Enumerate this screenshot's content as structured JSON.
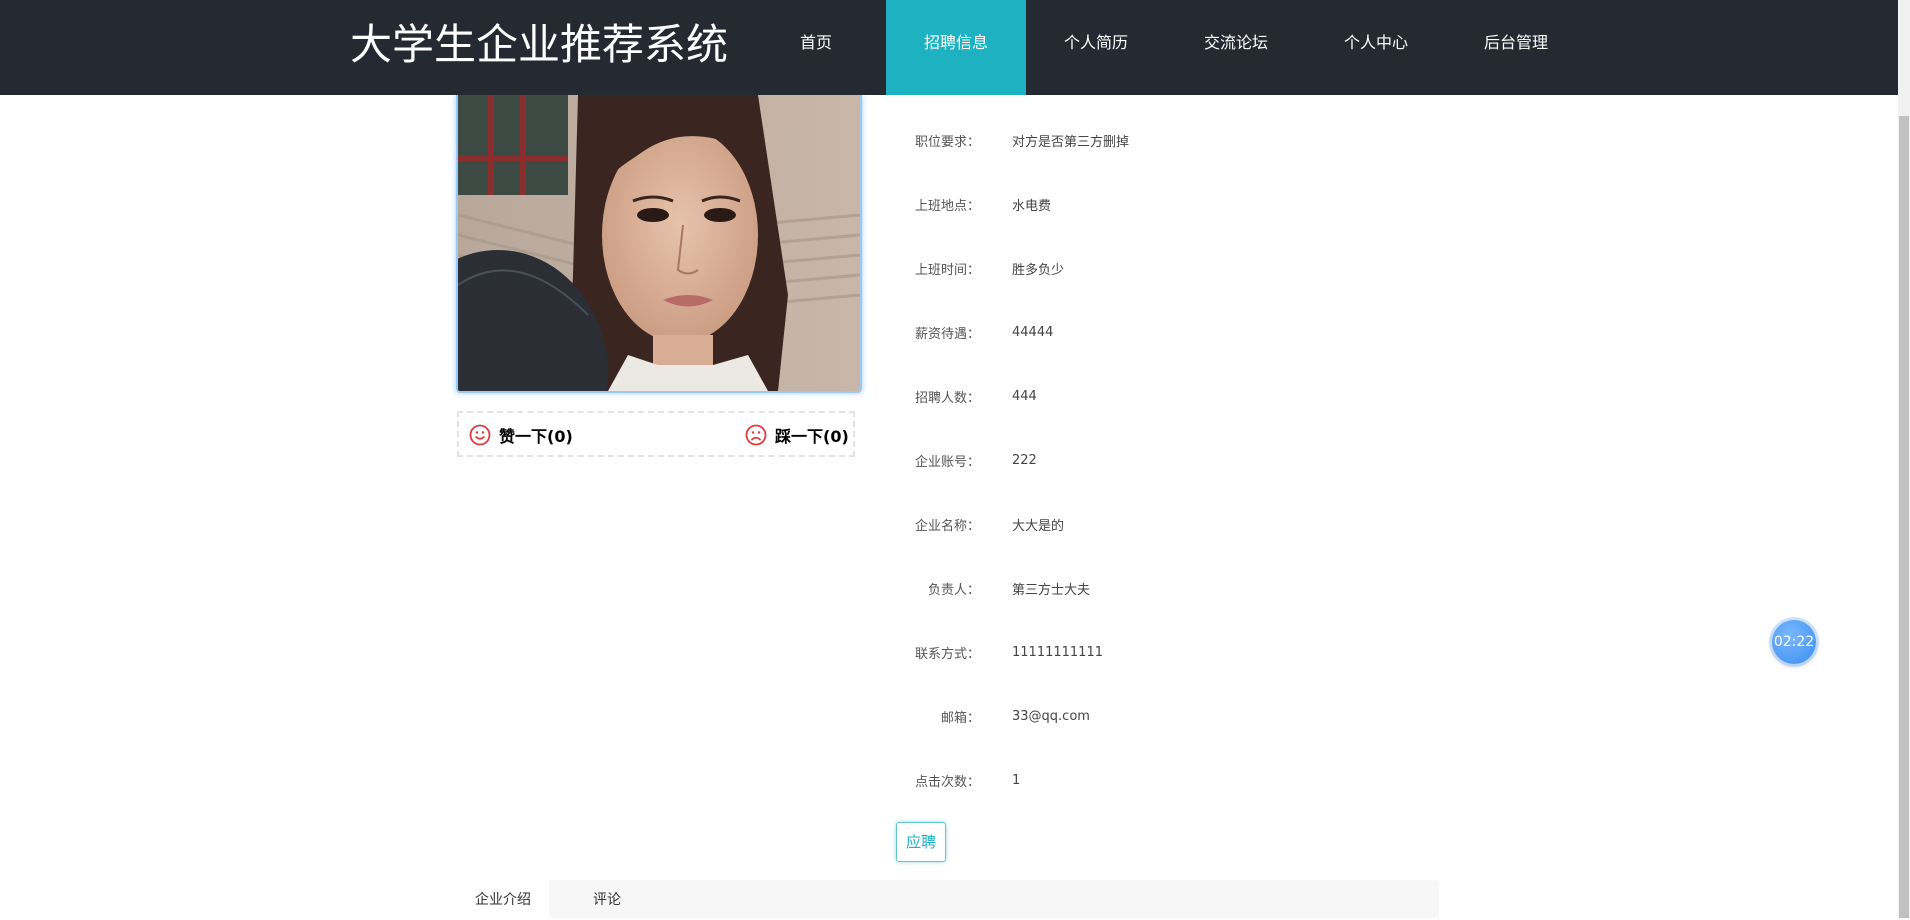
{
  "site": {
    "title": "大学生企业推荐系统"
  },
  "nav": {
    "items": [
      {
        "label": "首页"
      },
      {
        "label": "招聘信息"
      },
      {
        "label": "个人简历"
      },
      {
        "label": "交流论坛"
      },
      {
        "label": "个人中心"
      },
      {
        "label": "后台管理"
      }
    ],
    "active_index": 1
  },
  "votes": {
    "like_label": "赞一下(0)",
    "dislike_label": "踩一下(0)"
  },
  "details": [
    {
      "label": "职位要求：",
      "value": "对方是否第三方删掉"
    },
    {
      "label": "上班地点：",
      "value": "水电费"
    },
    {
      "label": "上班时间：",
      "value": "胜多负少"
    },
    {
      "label": "薪资待遇：",
      "value": "44444"
    },
    {
      "label": "招聘人数：",
      "value": "444"
    },
    {
      "label": "企业账号：",
      "value": "222"
    },
    {
      "label": "企业名称：",
      "value": "大大是的"
    },
    {
      "label": "负责人：",
      "value": "第三方士大夫"
    },
    {
      "label": "联系方式：",
      "value": "11111111111"
    },
    {
      "label": "邮箱：",
      "value": "33@qq.com"
    },
    {
      "label": "点击次数：",
      "value": "1"
    }
  ],
  "apply_label": "应聘",
  "tabs": [
    {
      "label": "企业介绍"
    },
    {
      "label": "评论"
    }
  ],
  "timer": {
    "text": "02:22"
  },
  "colors": {
    "header_bg": "#252932",
    "accent": "#1db1c1",
    "vote_icon": "#e0393e"
  },
  "icons": {
    "like": "smile-icon",
    "dislike": "frown-icon"
  }
}
